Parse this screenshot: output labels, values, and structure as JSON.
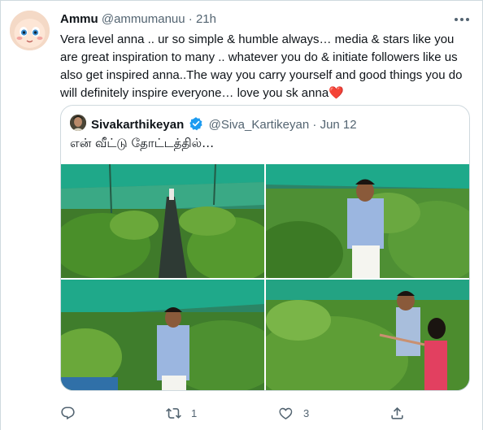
{
  "tweet": {
    "name": "Ammu",
    "handle": "@ammumanuu",
    "separator": "·",
    "time": "21h",
    "text": "Vera level anna .. ur so simple & humble always… media & stars like you are great inspiration to many .. whatever you do & initiate followers like us also get inspired anna..The way you carry yourself and good things you do will definitely inspire everyone… love you sk anna",
    "emoji": "❤️"
  },
  "quote": {
    "name": "Sivakarthikeyan",
    "handle": "@Siva_Kartikeyan",
    "separator": "·",
    "date": "Jun 12",
    "text": "என் வீட்டு தோட்டத்தில்…"
  },
  "actions": {
    "reply_count": "",
    "retweet_count": "1",
    "like_count": "3"
  },
  "icons": {
    "reply": "reply-icon",
    "retweet": "retweet-icon",
    "like": "heart-icon",
    "share": "share-icon",
    "more": "more-icon",
    "verified": "verified-badge-icon"
  },
  "colors": {
    "accent": "#1d9bf0",
    "secondary_text": "#536471",
    "border": "#cfd9de",
    "heart": "#e0245e"
  }
}
